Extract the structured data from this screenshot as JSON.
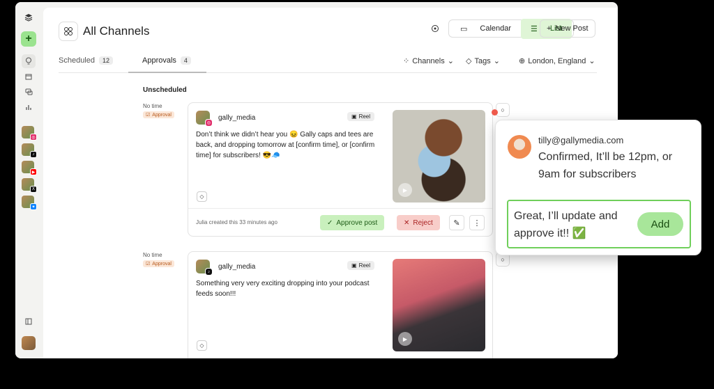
{
  "header": {
    "title": "All Channels",
    "calendar_label": "Calendar",
    "list_label": "List",
    "new_post_label": "New Post"
  },
  "tabs": [
    {
      "label": "Scheduled",
      "count": "12"
    },
    {
      "label": "Approvals",
      "count": "4"
    }
  ],
  "filters": {
    "channels": "Channels",
    "tags": "Tags",
    "location": "London, England"
  },
  "section_title": "Unscheduled",
  "posts": [
    {
      "time": "No time",
      "status": "Approval",
      "username": "gally_media",
      "network": "instagram",
      "type": "Reel",
      "body": "Don’t think we didn’t hear you 😖 Gally caps and tees are back, and dropping tomorrow at [confirm time], or [confirm time] for subscribers! 😎🧢",
      "created": "Julia created this 33 minutes ago",
      "approve_label": "Approve post",
      "reject_label": "Reject"
    },
    {
      "time": "No time",
      "status": "Approval",
      "username": "gally_media",
      "network": "tiktok",
      "type": "Reel",
      "body": "Something very very exciting dropping into your podcast feeds soon!!!"
    }
  ],
  "comment": {
    "author": "tilly@gallymedia.com",
    "text": "Confirmed, It’ll be 12pm, or 9am for subscribers",
    "reply_text": "Great, I’ll update and approve it!! ✅",
    "add_label": "Add"
  },
  "colors": {
    "accent_green": "#9be38f",
    "approve_bg": "#c9f0bd",
    "reject_bg": "#f8cdc9",
    "approval_badge": "#fbe7d8",
    "notification_dot": "#ef5a4c"
  }
}
